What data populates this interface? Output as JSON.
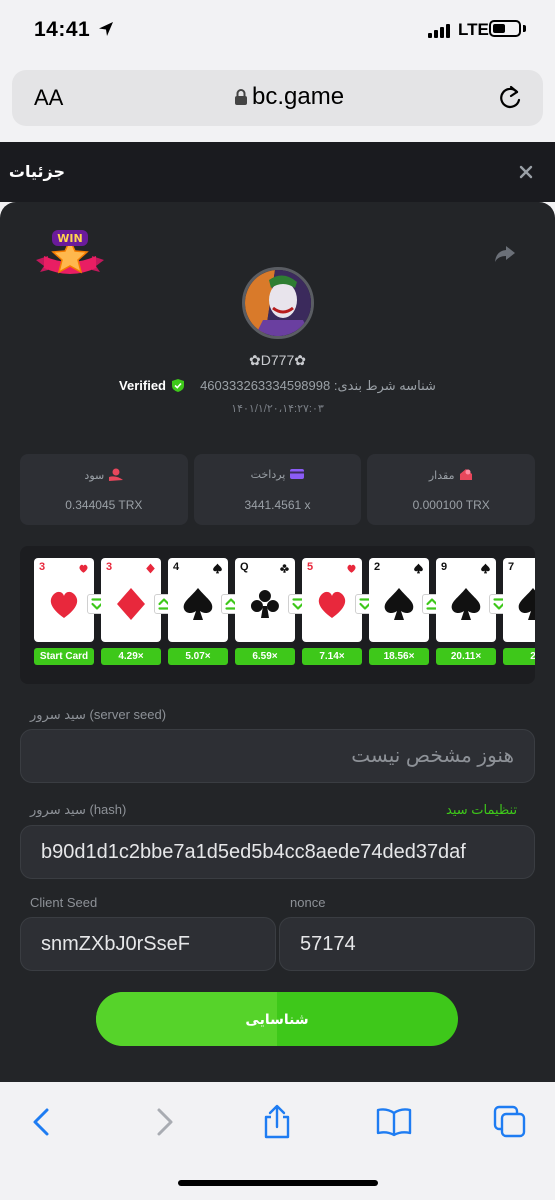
{
  "status_bar": {
    "time": "14:41",
    "network": "LTE"
  },
  "browser": {
    "text_size_label": "AA",
    "url": "bc.game"
  },
  "modal": {
    "title": "جزئیات"
  },
  "bet": {
    "badge": "WIN",
    "username": "D777",
    "verified_label": "Verified",
    "bet_id_label": "شناسه شرط بندی:",
    "bet_id": "460333263334598998",
    "date": "۱۴۰۱/۱/۲۰،۱۴:۲۷:۰۳"
  },
  "stats": [
    {
      "label": "مقدار",
      "value": "0.000100 TRX",
      "icon": "amount-icon",
      "color": "#e8475c"
    },
    {
      "label": "پرداخت",
      "value": "3441.4561 x",
      "icon": "payout-card-icon",
      "color": "#8b5cf6"
    },
    {
      "label": "سود",
      "value": "0.344045 TRX",
      "icon": "profit-icon",
      "color": "#e8475c"
    }
  ],
  "cards": [
    {
      "rank": "3",
      "suit": "heart",
      "color": "#e8283c",
      "multiplier": "Start Card",
      "next_arrow": "down"
    },
    {
      "rank": "3",
      "suit": "diamond",
      "color": "#e8283c",
      "multiplier": "4.29×",
      "next_arrow": "up"
    },
    {
      "rank": "4",
      "suit": "spade",
      "color": "#111111",
      "multiplier": "5.07×",
      "next_arrow": "up"
    },
    {
      "rank": "Q",
      "suit": "club",
      "color": "#111111",
      "multiplier": "6.59×",
      "next_arrow": "down"
    },
    {
      "rank": "5",
      "suit": "heart",
      "color": "#e8283c",
      "multiplier": "7.14×",
      "next_arrow": "down"
    },
    {
      "rank": "2",
      "suit": "spade",
      "color": "#111111",
      "multiplier": "18.56×",
      "next_arrow": "up"
    },
    {
      "rank": "9",
      "suit": "spade",
      "color": "#111111",
      "multiplier": "20.11×",
      "next_arrow": "down"
    },
    {
      "rank": "7",
      "suit": "spade",
      "color": "#111111",
      "multiplier": "2",
      "next_arrow": ""
    }
  ],
  "server_seed": {
    "label": "سید سرور (server seed)",
    "value": "هنوز مشخص نیست"
  },
  "server_hash": {
    "label": "سید سرور (hash)",
    "value": "b90d1d1c2bbe7a1d5ed5b4cc8aede74ded37daf",
    "settings_link": "تنظیمات سید"
  },
  "client_seed": {
    "label": "Client Seed",
    "value": "snmZXbJ0rSseF"
  },
  "nonce": {
    "label": "nonce",
    "value": "57174"
  },
  "verify_button": {
    "label": "شناسایی"
  }
}
